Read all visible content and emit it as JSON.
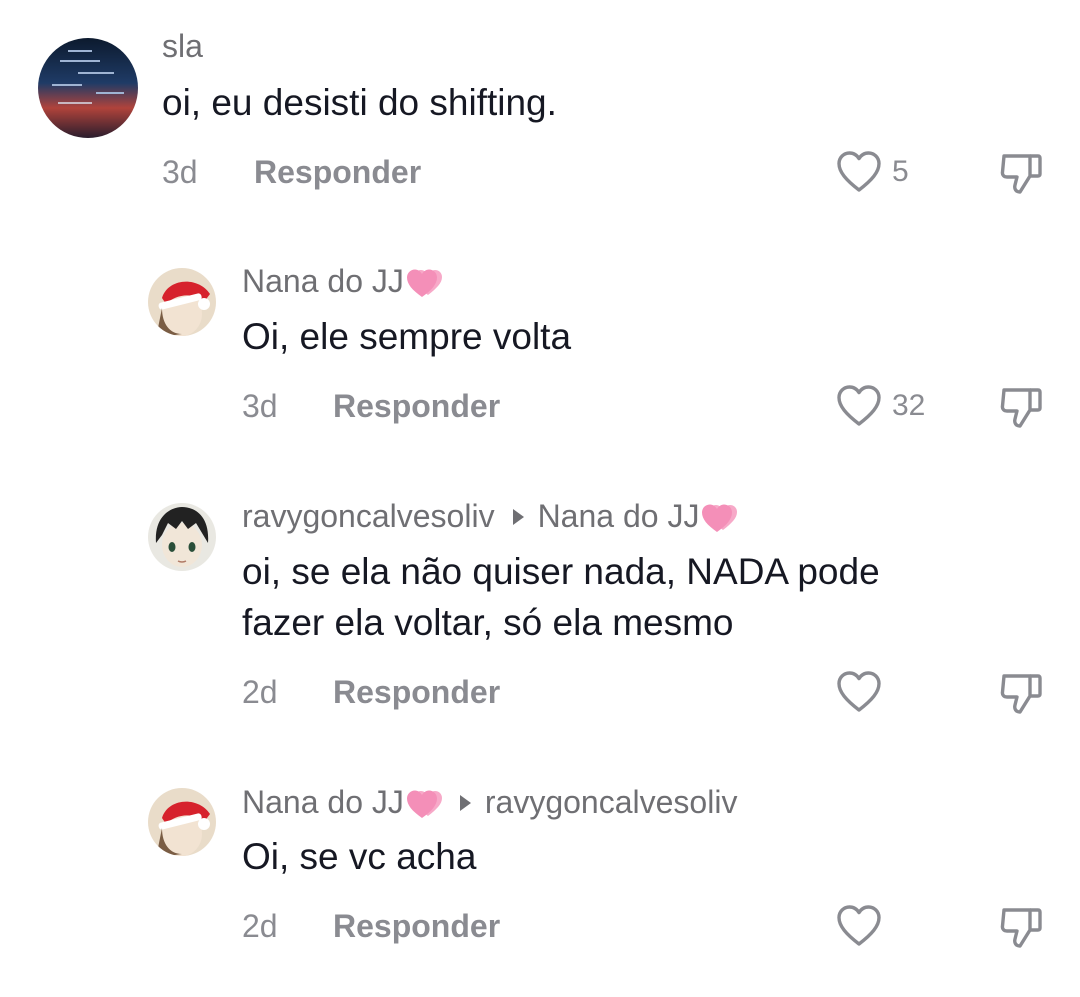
{
  "comments": [
    {
      "username": "sla",
      "reply_to": "",
      "text": [
        "oi, eu desisti do shifting."
      ],
      "age": "3d",
      "reply_label": "Responder",
      "likes": "5"
    },
    {
      "username": "Nana do JJ",
      "reply_to": "",
      "text": [
        "Oi, ele sempre volta"
      ],
      "age": "3d",
      "reply_label": "Responder",
      "likes": "32"
    },
    {
      "username": "ravygoncalvesoliv",
      "reply_to": "Nana do JJ",
      "text": [
        "oi, se ela não quiser nada, NADA pode",
        "fazer ela voltar, só ela mesmo"
      ],
      "age": "2d",
      "reply_label": "Responder",
      "likes": ""
    },
    {
      "username": "Nana do JJ",
      "reply_to": "ravygoncalvesoliv",
      "text": [
        "Oi, se vc acha"
      ],
      "age": "2d",
      "reply_label": "Responder",
      "likes": ""
    }
  ],
  "icons": {
    "like": "heart-outline-icon",
    "dislike": "thumbs-down-outline-icon",
    "name_emoji": "pink-hearts-emoji",
    "reply_indicator": "triangle-right-icon"
  },
  "colors": {
    "username": "#6f6f73",
    "text": "#161823",
    "meta": "#8a8b91",
    "emoji_heart": "#f48fb8"
  }
}
